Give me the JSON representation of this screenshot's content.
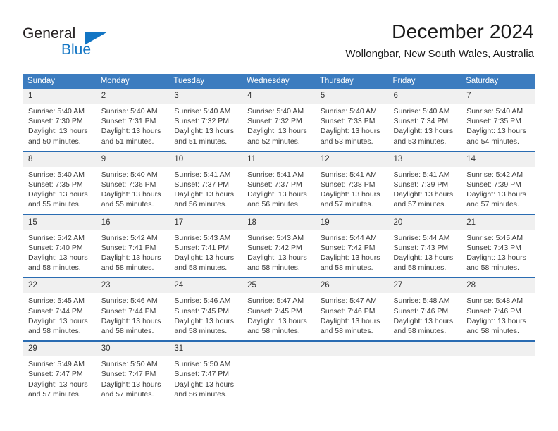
{
  "brand": {
    "name_top": "General",
    "name_bottom": "Blue",
    "accent_color": "#1275c4"
  },
  "header": {
    "title": "December 2024",
    "subtitle": "Wollongbar, New South Wales, Australia"
  },
  "calendar": {
    "header_color": "#3c7cbf",
    "weekdays": [
      "Sunday",
      "Monday",
      "Tuesday",
      "Wednesday",
      "Thursday",
      "Friday",
      "Saturday"
    ],
    "weeks": [
      [
        {
          "day": "1",
          "sunrise": "Sunrise: 5:40 AM",
          "sunset": "Sunset: 7:30 PM",
          "daylight": "Daylight: 13 hours and 50 minutes."
        },
        {
          "day": "2",
          "sunrise": "Sunrise: 5:40 AM",
          "sunset": "Sunset: 7:31 PM",
          "daylight": "Daylight: 13 hours and 51 minutes."
        },
        {
          "day": "3",
          "sunrise": "Sunrise: 5:40 AM",
          "sunset": "Sunset: 7:32 PM",
          "daylight": "Daylight: 13 hours and 51 minutes."
        },
        {
          "day": "4",
          "sunrise": "Sunrise: 5:40 AM",
          "sunset": "Sunset: 7:32 PM",
          "daylight": "Daylight: 13 hours and 52 minutes."
        },
        {
          "day": "5",
          "sunrise": "Sunrise: 5:40 AM",
          "sunset": "Sunset: 7:33 PM",
          "daylight": "Daylight: 13 hours and 53 minutes."
        },
        {
          "day": "6",
          "sunrise": "Sunrise: 5:40 AM",
          "sunset": "Sunset: 7:34 PM",
          "daylight": "Daylight: 13 hours and 53 minutes."
        },
        {
          "day": "7",
          "sunrise": "Sunrise: 5:40 AM",
          "sunset": "Sunset: 7:35 PM",
          "daylight": "Daylight: 13 hours and 54 minutes."
        }
      ],
      [
        {
          "day": "8",
          "sunrise": "Sunrise: 5:40 AM",
          "sunset": "Sunset: 7:35 PM",
          "daylight": "Daylight: 13 hours and 55 minutes."
        },
        {
          "day": "9",
          "sunrise": "Sunrise: 5:40 AM",
          "sunset": "Sunset: 7:36 PM",
          "daylight": "Daylight: 13 hours and 55 minutes."
        },
        {
          "day": "10",
          "sunrise": "Sunrise: 5:41 AM",
          "sunset": "Sunset: 7:37 PM",
          "daylight": "Daylight: 13 hours and 56 minutes."
        },
        {
          "day": "11",
          "sunrise": "Sunrise: 5:41 AM",
          "sunset": "Sunset: 7:37 PM",
          "daylight": "Daylight: 13 hours and 56 minutes."
        },
        {
          "day": "12",
          "sunrise": "Sunrise: 5:41 AM",
          "sunset": "Sunset: 7:38 PM",
          "daylight": "Daylight: 13 hours and 57 minutes."
        },
        {
          "day": "13",
          "sunrise": "Sunrise: 5:41 AM",
          "sunset": "Sunset: 7:39 PM",
          "daylight": "Daylight: 13 hours and 57 minutes."
        },
        {
          "day": "14",
          "sunrise": "Sunrise: 5:42 AM",
          "sunset": "Sunset: 7:39 PM",
          "daylight": "Daylight: 13 hours and 57 minutes."
        }
      ],
      [
        {
          "day": "15",
          "sunrise": "Sunrise: 5:42 AM",
          "sunset": "Sunset: 7:40 PM",
          "daylight": "Daylight: 13 hours and 58 minutes."
        },
        {
          "day": "16",
          "sunrise": "Sunrise: 5:42 AM",
          "sunset": "Sunset: 7:41 PM",
          "daylight": "Daylight: 13 hours and 58 minutes."
        },
        {
          "day": "17",
          "sunrise": "Sunrise: 5:43 AM",
          "sunset": "Sunset: 7:41 PM",
          "daylight": "Daylight: 13 hours and 58 minutes."
        },
        {
          "day": "18",
          "sunrise": "Sunrise: 5:43 AM",
          "sunset": "Sunset: 7:42 PM",
          "daylight": "Daylight: 13 hours and 58 minutes."
        },
        {
          "day": "19",
          "sunrise": "Sunrise: 5:44 AM",
          "sunset": "Sunset: 7:42 PM",
          "daylight": "Daylight: 13 hours and 58 minutes."
        },
        {
          "day": "20",
          "sunrise": "Sunrise: 5:44 AM",
          "sunset": "Sunset: 7:43 PM",
          "daylight": "Daylight: 13 hours and 58 minutes."
        },
        {
          "day": "21",
          "sunrise": "Sunrise: 5:45 AM",
          "sunset": "Sunset: 7:43 PM",
          "daylight": "Daylight: 13 hours and 58 minutes."
        }
      ],
      [
        {
          "day": "22",
          "sunrise": "Sunrise: 5:45 AM",
          "sunset": "Sunset: 7:44 PM",
          "daylight": "Daylight: 13 hours and 58 minutes."
        },
        {
          "day": "23",
          "sunrise": "Sunrise: 5:46 AM",
          "sunset": "Sunset: 7:44 PM",
          "daylight": "Daylight: 13 hours and 58 minutes."
        },
        {
          "day": "24",
          "sunrise": "Sunrise: 5:46 AM",
          "sunset": "Sunset: 7:45 PM",
          "daylight": "Daylight: 13 hours and 58 minutes."
        },
        {
          "day": "25",
          "sunrise": "Sunrise: 5:47 AM",
          "sunset": "Sunset: 7:45 PM",
          "daylight": "Daylight: 13 hours and 58 minutes."
        },
        {
          "day": "26",
          "sunrise": "Sunrise: 5:47 AM",
          "sunset": "Sunset: 7:46 PM",
          "daylight": "Daylight: 13 hours and 58 minutes."
        },
        {
          "day": "27",
          "sunrise": "Sunrise: 5:48 AM",
          "sunset": "Sunset: 7:46 PM",
          "daylight": "Daylight: 13 hours and 58 minutes."
        },
        {
          "day": "28",
          "sunrise": "Sunrise: 5:48 AM",
          "sunset": "Sunset: 7:46 PM",
          "daylight": "Daylight: 13 hours and 58 minutes."
        }
      ],
      [
        {
          "day": "29",
          "sunrise": "Sunrise: 5:49 AM",
          "sunset": "Sunset: 7:47 PM",
          "daylight": "Daylight: 13 hours and 57 minutes."
        },
        {
          "day": "30",
          "sunrise": "Sunrise: 5:50 AM",
          "sunset": "Sunset: 7:47 PM",
          "daylight": "Daylight: 13 hours and 57 minutes."
        },
        {
          "day": "31",
          "sunrise": "Sunrise: 5:50 AM",
          "sunset": "Sunset: 7:47 PM",
          "daylight": "Daylight: 13 hours and 56 minutes."
        },
        {
          "day": "",
          "sunrise": "",
          "sunset": "",
          "daylight": ""
        },
        {
          "day": "",
          "sunrise": "",
          "sunset": "",
          "daylight": ""
        },
        {
          "day": "",
          "sunrise": "",
          "sunset": "",
          "daylight": ""
        },
        {
          "day": "",
          "sunrise": "",
          "sunset": "",
          "daylight": ""
        }
      ]
    ]
  }
}
